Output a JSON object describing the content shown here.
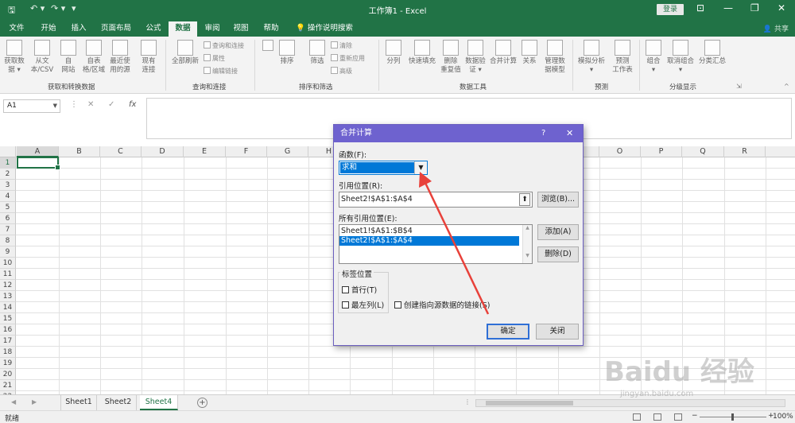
{
  "titlebar": {
    "title": "工作簿1  -  Excel",
    "login": "登录"
  },
  "tabs": [
    "文件",
    "开始",
    "插入",
    "页面布局",
    "公式",
    "数据",
    "审阅",
    "视图",
    "帮助",
    "操作说明搜索"
  ],
  "active_tab": "数据",
  "share": "共享",
  "ribbon": {
    "groups": {
      "get": "获取和转换数据",
      "query": "查询和连接",
      "sort": "排序和筛选",
      "tools": "数据工具",
      "forecast": "预测",
      "outline": "分级显示"
    },
    "buttons": {
      "get_data": "获取数\n据 ▾",
      "from_csv": "从文\n本/CSV",
      "from_web": "自\n网站",
      "from_table": "自表\n格/区域",
      "recent": "最近使\n用的源",
      "existing": "现有\n连接",
      "refresh_all": "全部刷新",
      "queries": "查询和连接",
      "properties": "属性",
      "edit_links": "编辑链接",
      "sort": "排序",
      "filter": "筛选",
      "clear": "清除",
      "reapply": "重新应用",
      "advanced": "高级",
      "split": "分列",
      "flash_fill": "快速填充",
      "remove_dup": "删除\n重复值",
      "validation": "数据验\n证 ▾",
      "consolidate": "合并计算",
      "relations": "关系",
      "data_model": "管理数\n据模型",
      "whatif": "模拟分析\n▾",
      "forecast_sheet": "预测\n工作表",
      "group": "组合\n▾",
      "ungroup": "取消组合\n▾",
      "subtotal": "分类汇总"
    }
  },
  "formula_bar": {
    "name_box": "A1",
    "cancel": "✕",
    "enter": "✓",
    "fx": "fx",
    "formula": ""
  },
  "columns": [
    "A",
    "B",
    "C",
    "D",
    "E",
    "F",
    "G",
    "H",
    "I",
    "J",
    "K",
    "L",
    "M",
    "N",
    "O",
    "P",
    "Q",
    "R"
  ],
  "rows": [
    "1",
    "2",
    "3",
    "4",
    "5",
    "6",
    "7",
    "8",
    "9",
    "10",
    "11",
    "12",
    "13",
    "14",
    "15",
    "16",
    "17",
    "18",
    "19",
    "20",
    "21",
    "22"
  ],
  "sheets": [
    "Sheet1",
    "Sheet2",
    "Sheet4"
  ],
  "active_sheet": "Sheet4",
  "status": {
    "ready": "就绪",
    "zoom": "100%"
  },
  "dialog": {
    "title": "合并计算",
    "help": "?",
    "close": "✕",
    "function_label": "函数(F):",
    "function_value": "求和",
    "reference_label": "引用位置(R):",
    "reference_value": "Sheet2!$A$1:$A$4",
    "browse": "浏览(B)...",
    "all_refs_label": "所有引用位置(E):",
    "all_refs": [
      "Sheet1!$A$1:$B$4",
      "Sheet2!$A$1:$A$4"
    ],
    "selected_ref": 1,
    "add": "添加(A)",
    "delete": "删除(D)",
    "labels_group": "标签位置",
    "top_row": "首行(T)",
    "left_col": "最左列(L)",
    "link_source": "创建指向源数据的链接(S)",
    "ok": "确定",
    "close_btn": "关闭"
  },
  "annotation_color": "#e8413a",
  "watermark": {
    "text": "Baidu 经验",
    "url": "jingyan.baidu.com"
  }
}
